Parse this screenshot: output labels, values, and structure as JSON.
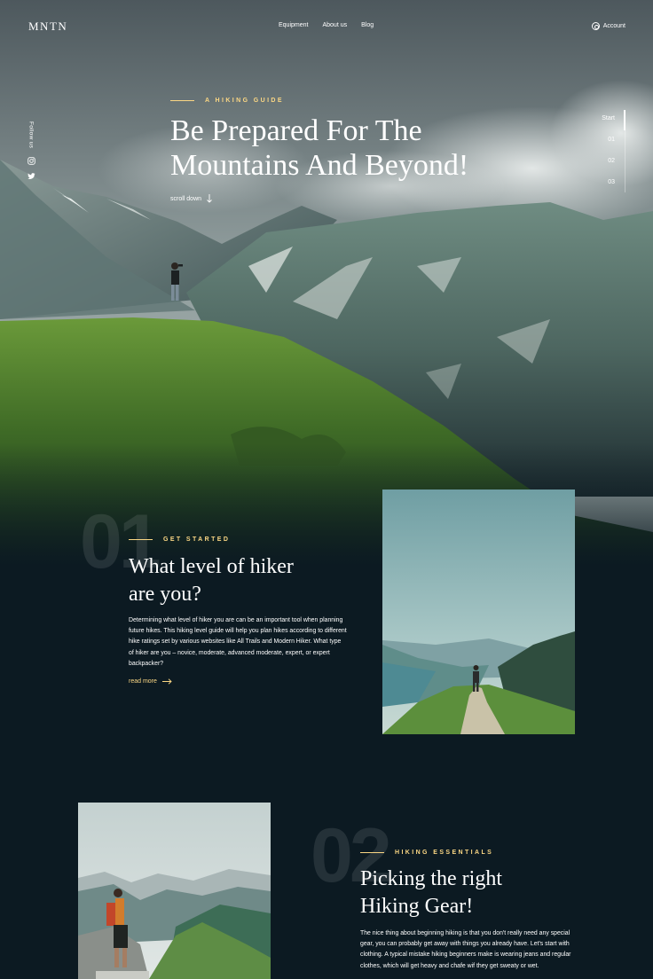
{
  "header": {
    "logo": "MNTN",
    "nav": [
      "Equipment",
      "About us",
      "Blog"
    ],
    "account_label": "Account",
    "icons": {
      "account": "user-circle-icon"
    }
  },
  "social": {
    "label": "Follow us",
    "icons": [
      "instagram-icon",
      "twitter-icon"
    ]
  },
  "hero": {
    "eyebrow": "A HIKING GUIDE",
    "title_line1": "Be Prepared For The",
    "title_line2": "Mountains And Beyond!",
    "scroll_label": "scroll down",
    "icons": {
      "scroll": "arrow-down-icon"
    }
  },
  "steps": {
    "items": [
      "Start",
      "01",
      "02",
      "03"
    ],
    "active_index": 0
  },
  "sections": [
    {
      "number": "01",
      "eyebrow": "GET STARTED",
      "title_line1": "What level of  hiker",
      "title_line2": "are you?",
      "body": "Determining what level of hiker you are can be an important tool when planning future hikes. This hiking level guide will help you plan hikes according to different hike ratings set by various websites like All Trails and Modern Hiker. What type of hiker are you – novice, moderate, advanced moderate, expert, or expert backpacker?",
      "link_label": "read more",
      "icon": "arrow-right-icon"
    },
    {
      "number": "02",
      "eyebrow": "HIKING ESSENTIALS",
      "title_line1": "Picking the right",
      "title_line2": "Hiking Gear!",
      "body": "The nice thing about beginning hiking is that you don't really need any special gear, you can probably get away with things you already have. Let's start with clothing. A typical mistake hiking beginners make is wearing jeans and regular clothes, which will get heavy and chafe wif they get sweaty or wet."
    }
  ],
  "colors": {
    "background": "#0c1a22",
    "accent": "#fbd784",
    "text": "#ffffff"
  }
}
